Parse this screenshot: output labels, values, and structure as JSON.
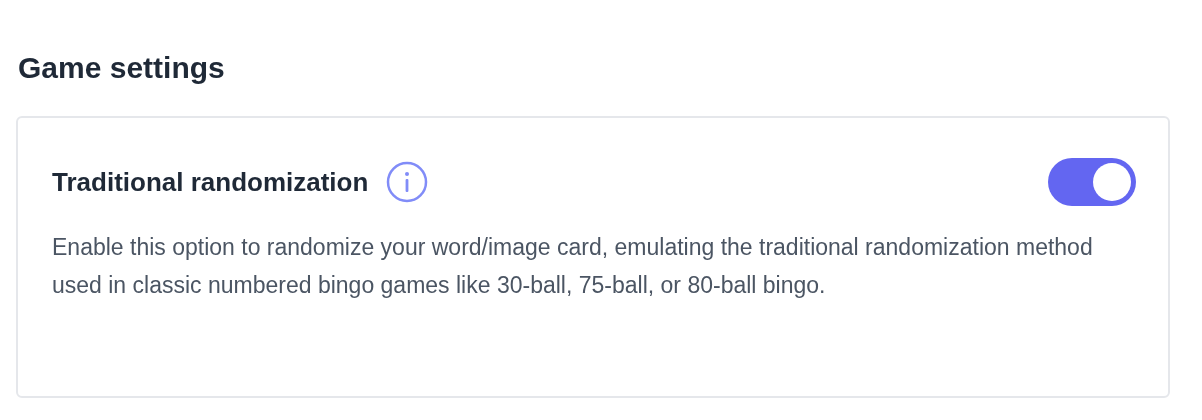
{
  "heading": "Game settings",
  "setting": {
    "title": "Traditional randomization",
    "on": true,
    "description": "Enable this option to randomize your word/image card, emulating the traditional randomization method used in classic numbered bingo games like 30-ball, 75-ball, or 80-ball bingo."
  }
}
